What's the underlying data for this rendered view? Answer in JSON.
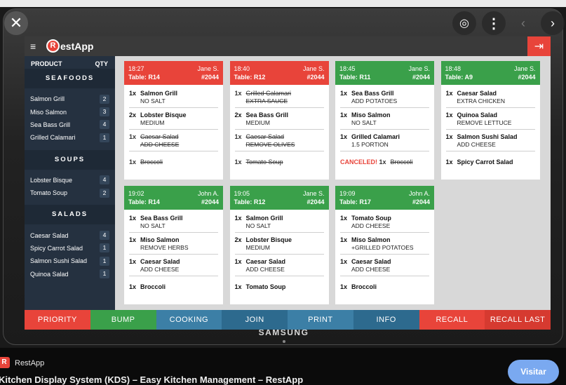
{
  "viewer": {
    "close_glyph": "✕",
    "lens_glyph": "◎",
    "more_glyph": "⋮",
    "prev_glyph": "‹",
    "next_glyph": "›"
  },
  "app": {
    "logo_letter": "R",
    "logo_text": "estApp",
    "menu_glyph": "≡",
    "exit_glyph": "⇥"
  },
  "sidebar": {
    "col_product": "PRODUCT",
    "col_qty": "QTY",
    "sections": [
      {
        "title": "SEAFOODS",
        "items": [
          {
            "name": "Salmon Grill",
            "qty": "2"
          },
          {
            "name": "Miso Salmon",
            "qty": "3"
          },
          {
            "name": "Sea Bass Grill",
            "qty": "4"
          },
          {
            "name": "Grilled Calamari",
            "qty": "1"
          }
        ]
      },
      {
        "title": "SOUPS",
        "items": [
          {
            "name": "Lobster Bisque",
            "qty": "4"
          },
          {
            "name": "Tomato Soup",
            "qty": "2"
          }
        ]
      },
      {
        "title": "SALADS",
        "items": [
          {
            "name": "Caesar Salad",
            "qty": "4"
          },
          {
            "name": "Spicy Carrot Salad",
            "qty": "1"
          },
          {
            "name": "Salmon Sushi Salad",
            "qty": "1"
          },
          {
            "name": "Quinoa Salad",
            "qty": "1"
          }
        ]
      }
    ]
  },
  "orders": [
    {
      "time": "18:27",
      "server": "Jane S.",
      "table": "Table: R14",
      "number": "#2044",
      "status": "red",
      "items": [
        {
          "qty": "1x",
          "name": "Salmon Grill",
          "mod": "NO SALT",
          "struck": false
        },
        {
          "qty": "2x",
          "name": "Lobster Bisque",
          "mod": "MEDIUM",
          "struck": false
        },
        {
          "qty": "1x",
          "name": "Caesar Salad",
          "mod": "ADD CHEESE",
          "struck": true
        },
        {
          "qty": "1x",
          "name": "Broccoli",
          "mod": "",
          "struck": true
        }
      ]
    },
    {
      "time": "18:40",
      "server": "Jane S.",
      "table": "Table: R12",
      "number": "#2044",
      "status": "red",
      "items": [
        {
          "qty": "1x",
          "name": "Grilled Calamari",
          "mod": "EXTRA SAUCE",
          "struck": true
        },
        {
          "qty": "2x",
          "name": "Sea Bass Grill",
          "mod": "MEDIUM",
          "struck": false
        },
        {
          "qty": "1x",
          "name": "Caesar Salad",
          "mod": "REMOVE OLIVES",
          "struck": true
        },
        {
          "qty": "1x",
          "name": "Tomato Soup",
          "mod": "",
          "struck": true
        }
      ]
    },
    {
      "time": "18:45",
      "server": "Jane S.",
      "table": "Table: R11",
      "number": "#2044",
      "status": "green",
      "items": [
        {
          "qty": "1x",
          "name": "Sea Bass Grill",
          "mod": "ADD POTATOES",
          "struck": false
        },
        {
          "qty": "1x",
          "name": "Miso Salmon",
          "mod": "NO SALT",
          "struck": false
        },
        {
          "qty": "1x",
          "name": "Grilled Calamari",
          "mod": "1.5 PORTION",
          "struck": false
        },
        {
          "qty": "1x",
          "name": "Broccoli",
          "mod": "",
          "struck": true,
          "canceled_label": "CANCELED!"
        }
      ]
    },
    {
      "time": "18:48",
      "server": "Jane S.",
      "table": "Table: A9",
      "number": "#2044",
      "status": "green",
      "items": [
        {
          "qty": "1x",
          "name": "Caesar Salad",
          "mod": "EXTRA CHICKEN",
          "struck": false
        },
        {
          "qty": "1x",
          "name": "Quinoa Salad",
          "mod": "REMOVE LETTUCE",
          "struck": false
        },
        {
          "qty": "1x",
          "name": "Salmon Sushi Salad",
          "mod": "ADD CHEESE",
          "struck": false
        },
        {
          "qty": "1x",
          "name": "Spicy Carrot Salad",
          "mod": "",
          "struck": false
        }
      ]
    },
    {
      "time": "19:02",
      "server": "John A.",
      "table": "Table: R14",
      "number": "#2044",
      "status": "green",
      "items": [
        {
          "qty": "1x",
          "name": "Sea Bass Grill",
          "mod": "NO SALT",
          "struck": false
        },
        {
          "qty": "1x",
          "name": "Miso Salmon",
          "mod": "REMOVE HERBS",
          "struck": false
        },
        {
          "qty": "1x",
          "name": "Caesar Salad",
          "mod": "ADD CHEESE",
          "struck": false
        },
        {
          "qty": "1x",
          "name": "Broccoli",
          "mod": "",
          "struck": false
        }
      ]
    },
    {
      "time": "19:05",
      "server": "Jane S.",
      "table": "Table: R12",
      "number": "#2044",
      "status": "green",
      "items": [
        {
          "qty": "1x",
          "name": "Salmon Grill",
          "mod": "NO SALT",
          "struck": false
        },
        {
          "qty": "2x",
          "name": "Lobster Bisque",
          "mod": "MEDIUM",
          "struck": false
        },
        {
          "qty": "1x",
          "name": "Caesar Salad",
          "mod": "ADD CHEESE",
          "struck": false
        },
        {
          "qty": "1x",
          "name": "Tomato Soup",
          "mod": "",
          "struck": false
        }
      ]
    },
    {
      "time": "19:09",
      "server": "John A.",
      "table": "Table: R17",
      "number": "#2044",
      "status": "green",
      "items": [
        {
          "qty": "1x",
          "name": "Tomato Soup",
          "mod": "ADD CHEESE",
          "struck": false
        },
        {
          "qty": "1x",
          "name": "Miso Salmon",
          "mod": "+GRILLED POTATOES",
          "struck": false
        },
        {
          "qty": "1x",
          "name": "Caesar Salad",
          "mod": "ADD CHEESE",
          "struck": false
        },
        {
          "qty": "1x",
          "name": "Broccoli",
          "mod": "",
          "struck": false
        }
      ]
    }
  ],
  "actions": [
    {
      "label": "PRIORITY",
      "color": "#e8443a"
    },
    {
      "label": "BUMP",
      "color": "#3aa04a"
    },
    {
      "label": "COOKING",
      "color": "#3c7fa6"
    },
    {
      "label": "JOIN",
      "color": "#2d6a8e"
    },
    {
      "label": "PRINT",
      "color": "#3c7fa6"
    },
    {
      "label": "INFO",
      "color": "#2d6a8e"
    },
    {
      "label": "RECALL",
      "color": "#e8443a"
    },
    {
      "label": "RECALL LAST",
      "color": "#d63a30"
    }
  ],
  "colors": {
    "red": "#e8443a",
    "green": "#3aa04a"
  },
  "device": {
    "brand": "SAMSUNG"
  },
  "footer": {
    "source_icon": "R",
    "source_name": "RestApp",
    "title": "Kitchen Display System (KDS) – Easy Kitchen Management – RestApp",
    "visit_label": "Visitar"
  }
}
